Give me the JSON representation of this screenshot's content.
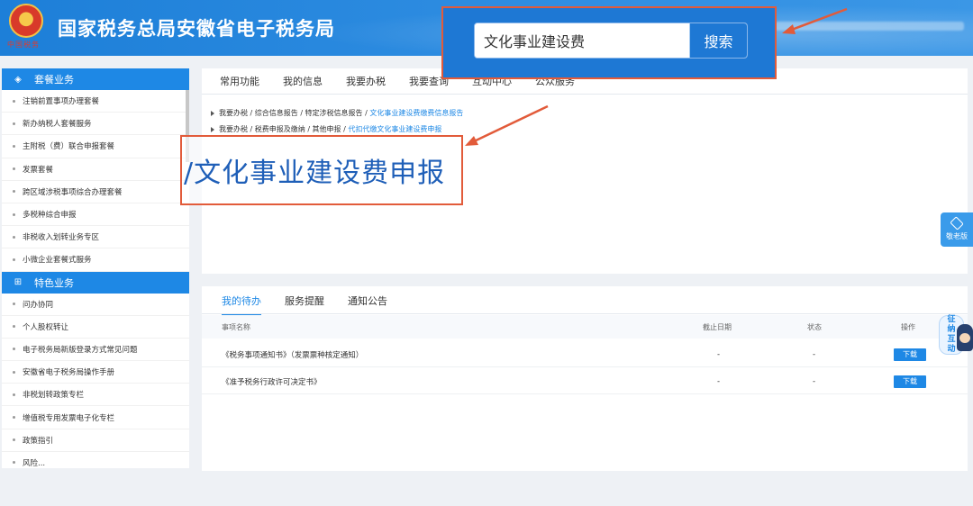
{
  "header": {
    "site_title": "国家税务总局安徽省电子税务局",
    "emblem_text": "中国税务"
  },
  "search": {
    "value": "文化事业建设费",
    "button_label": "搜索"
  },
  "sidebar": {
    "section1_title": "套餐业务",
    "section1_items": [
      "注销前置事项办理套餐",
      "新办纳税人套餐服务",
      "主附税（费）联合申报套餐",
      "发票套餐",
      "跨区域涉税事项综合办理套餐",
      "多税种综合申报",
      "非税收入划转业务专区",
      "小微企业套餐式服务"
    ],
    "section2_title": "特色业务",
    "section2_items": [
      "问办协同",
      "个人股权转让",
      "电子税务局新版登录方式常见问题",
      "安徽省电子税务局操作手册",
      "非税划转政策专栏",
      "增值税专用发票电子化专栏",
      "政策指引",
      "风险..."
    ]
  },
  "main_tabs": [
    "常用功能",
    "我的信息",
    "我要办税",
    "我要查询",
    "互动中心",
    "公众服务"
  ],
  "results": [
    {
      "path": "我要办税 / 综合信息报告 / 特定涉税信息报告 / ",
      "target": "文化事业建设费缴费信息报告"
    },
    {
      "path": "我要办税 / 税费申报及缴纳 / 其他申报 / ",
      "target": "代扣代缴文化事业建设费申报"
    }
  ],
  "zoom_label": "/文化事业建设费申报",
  "bottom_tabs": [
    "我的待办",
    "服务提醒",
    "通知公告"
  ],
  "table": {
    "headers": [
      "事项名称",
      "截止日期",
      "状态",
      "操作"
    ],
    "rows": [
      {
        "name": "《税务事项通知书》（发票票种核定通知）",
        "deadline": "-",
        "status": "-",
        "action": "下载"
      },
      {
        "name": "《准予税务行政许可决定书》",
        "deadline": "-",
        "status": "-",
        "action": "下载"
      }
    ]
  },
  "float": {
    "elder_label": "敬老版",
    "mascot_text": [
      "征",
      "纳",
      "互",
      "动"
    ]
  },
  "colors": {
    "primary": "#1e88e5",
    "header": "#2c8be0",
    "annotation": "#e25b3a"
  }
}
